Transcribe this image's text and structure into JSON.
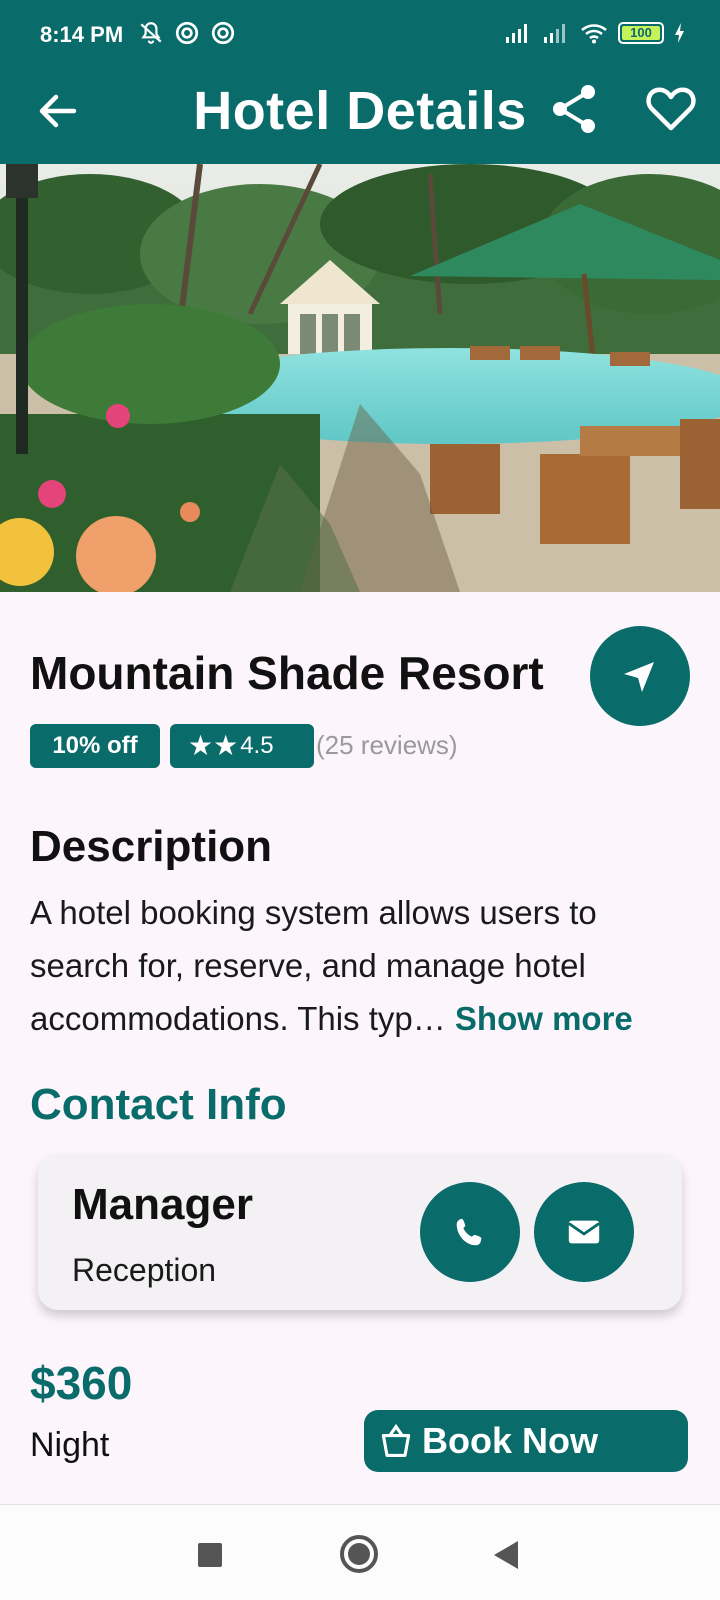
{
  "status_bar": {
    "time": "8:14 PM",
    "battery": "100",
    "icons": [
      "mute-bell-icon",
      "dnd-icon",
      "dnd-icon",
      "signal-icon",
      "signal-icon",
      "wifi-icon",
      "battery-icon",
      "charging-icon"
    ]
  },
  "app_bar": {
    "title": "Hotel Details",
    "back_icon": "arrow-left-icon",
    "share_icon": "share-icon",
    "favorite_icon": "heart-outline-icon",
    "background": "#0a6b6b"
  },
  "hotel": {
    "name": "Mountain Shade Resort",
    "discount": "10% off",
    "stars": "★★",
    "rating": "4.5",
    "reviews": "(25 reviews)",
    "navigate_icon": "navigation-arrow-icon"
  },
  "description": {
    "title": "Description",
    "text": "A hotel booking system allows users to search for, reserve, and manage hotel accommodations. This typ…",
    "show_more": "Show more"
  },
  "contact": {
    "title": "Contact Info",
    "name": "Manager",
    "role": "Reception",
    "call_icon": "phone-icon",
    "mail_icon": "mail-icon"
  },
  "booking": {
    "price": "$360",
    "unit": "Night",
    "button_label": "Book Now",
    "button_icon": "bag-icon"
  },
  "colors": {
    "primary": "#0a6b6b",
    "background": "#fcf6fc",
    "muted_text": "#9a9a9a"
  }
}
